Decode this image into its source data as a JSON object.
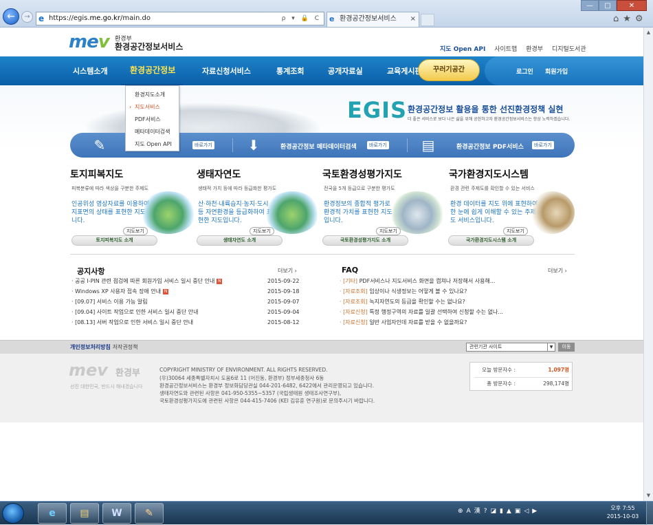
{
  "browser": {
    "url_prefix": "https://egis.",
    "url_domain": "me.go.kr",
    "url_path": "/main.do",
    "url_controls": "ρ ▾ 🔒 C",
    "tab_title": "환경공간정보서비스",
    "tab_close": "×",
    "nav_back": "←",
    "nav_forward": "→",
    "ie_glyph": "e",
    "window_controls": {
      "min": "—",
      "max": "□",
      "close": "✕"
    },
    "right_tools": "⌂★⚙"
  },
  "header": {
    "logo": {
      "me": "me",
      "v": "v"
    },
    "ministry": "환경부",
    "service_name": "환경공간정보서비스",
    "top_links": [
      "지도 Open API",
      "사이트맵",
      "환경부",
      "디지털도서관"
    ]
  },
  "nav": {
    "items": [
      "시스템소개",
      "환경공간정보",
      "자료신청서비스",
      "통계조회",
      "공개자료실",
      "교육게시판"
    ],
    "active": "환경공간정보",
    "kkum": "꾸러기공간",
    "login": "로그인",
    "signup": "회원가입"
  },
  "dropdown": {
    "items": [
      "환경지도소개",
      "지도서비스",
      "PDF서비스",
      "메타데이터검색",
      "지도 Open API"
    ],
    "active": "지도서비스"
  },
  "banner": {
    "egis": "EGIS",
    "slogan": "환경공간정보 활용을 통한 선진환경정책 실현",
    "sub": "더 좋은 서비스로 보다 나은 삶을 위해 공헌하고자 환경공간정보서비스는 항상 노력하겠습니다."
  },
  "quickbar": {
    "items": [
      {
        "label": "",
        "button": "바로가기",
        "icon": "✎"
      },
      {
        "label": "환경공간정보 메타데이터검색",
        "button": "바로가기",
        "icon": "⬇"
      },
      {
        "label": "환경공간정보 PDF서비스",
        "button": "바로가기",
        "icon": "▤"
      }
    ]
  },
  "maps": [
    {
      "title": "토지피복지도",
      "sub": "피복분류에 따라 색상을 구분한 주제도",
      "desc": "인공위성 영상자료를 이용하여 지표면의 상태를 표현한 지도입니다.",
      "view": "지도보기",
      "intro": "토지피복지도 소개"
    },
    {
      "title": "생태자연도",
      "sub": "생태적 가치 등에 따라 등급화한 평가도",
      "desc": "산·하천·내륙습지·농지·도시 등 자연환경을 등급화하여 표현한 지도입니다.",
      "view": "지도보기",
      "intro": "생태자연도 소개"
    },
    {
      "title": "국토환경성평가지도",
      "sub": "전국을 5개 등급으로 구분한 평가도",
      "desc": "환경정보의 종합적 평가로 환경적 가치를 표현한 지도입니다.",
      "view": "지도보기",
      "intro": "국토환경성평가지도 소개"
    },
    {
      "title": "국가환경지도시스템",
      "sub": "환경 관련 주제도를 확인할 수 있는 서비스",
      "desc": "환경 데이터를 지도 위에 표현하여 한 눈에 쉽게 이해할 수 있는 주제도 서비스입니다.",
      "view": "지도보기",
      "intro": "국가환경지도시스템 소개"
    }
  ],
  "notices": {
    "title": "공지사항",
    "more": "더보기 ›",
    "new_badge": "N",
    "items": [
      {
        "text": "· 공공 I-PIN 관련 점검에 따른 회원가입 서비스 일시 중단 안내",
        "date": "2015-09-22",
        "new": true
      },
      {
        "text": "· Windows XP 사용자 접속 장애 안내",
        "date": "2015-09-18",
        "new": true
      },
      {
        "text": "· [09.07] 서비스 이용 가능 알림",
        "date": "2015-09-07",
        "new": false
      },
      {
        "text": "· [09.04] 사이트 작업으로 인한 서비스 일시 중단 안내",
        "date": "2015-09-04",
        "new": false
      },
      {
        "text": "· [08.13] 서버 작업으로 인한 서비스 일시 중단 안내",
        "date": "2015-08-12",
        "new": false
      }
    ]
  },
  "faq": {
    "title": "FAQ",
    "more": "더보기 ›",
    "items": [
      {
        "cat": "· [기타]",
        "text": " PDF서비스나 지도서비스 화면을 캡쳐나 저장해서 사용해..."
      },
      {
        "cat": "· [자료조회]",
        "text": " 임상이나 식생정보는 어떻게 볼 수 있나요?"
      },
      {
        "cat": "· [자료조회]",
        "text": " 녹지자연도의 등급을 확인할 수는 없나요?"
      },
      {
        "cat": "· [자료신청]",
        "text": " 특정 행정구역의 자료를 일괄 선택하여 신청할 수는 없나..."
      },
      {
        "cat": "· [자료신청]",
        "text": " 일반 사업자인데 자료를 받을 수 없을까요?"
      }
    ]
  },
  "footer": {
    "privacy": "개인정보처리방침",
    "copyright_policy": "저작권정책",
    "related_select": "관련기관 사이트",
    "go": "이동",
    "logo_ministry": "환경부",
    "slogan": "선진 대한민국, 반드시 해내겠습니다",
    "lines": [
      "COPYRIGHT MINISTRY OF ENVIRONMENT. ALL RIGHTS RESERVED.",
      "(우)30064 세종특별자치시 도움6로 11 (어진동, 환경부) 정부세종청사 6동",
      "환경공간정보서비스는 환경부 정보화담당관실 044-201-6482, 6422에서 관리운영되고 있습니다.",
      "생태자연도와 관련된 사항은 041-950-5355~5357 (국립생태원 생태조사연구부),",
      "국토환경성평가지도에 관련된 사항은 044-415-7406 (KEI 김유훈 연구원)로 문의주시기 바랍니다."
    ],
    "visitors": {
      "today_label": "오늘 방문자수 :",
      "today": "1,097명",
      "total_label": "총 방문자수 :",
      "total": "298,174명"
    }
  },
  "taskbar": {
    "apps": [
      "e",
      "▤",
      "W",
      "✎"
    ],
    "tray": "⊕A漢?◪▮▲▣◁▶",
    "time": "오후 7:55",
    "date": "2015-10-03"
  }
}
